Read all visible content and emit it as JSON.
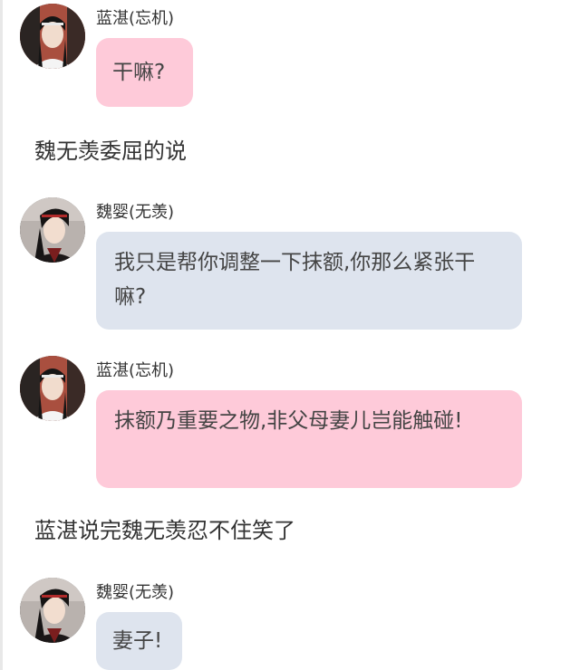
{
  "messages": [
    {
      "sender": "蓝湛(忘机)",
      "avatar": "lan-zhan-avatar",
      "text": "干嘛?",
      "bubble_color": "#fecad9"
    },
    {
      "sender": "魏婴(无羡)",
      "avatar": "wei-ying-avatar",
      "text": "我只是帮你调整一下抹额,你那么紧张干嘛?",
      "bubble_color": "#dee4ee"
    },
    {
      "sender": "蓝湛(忘机)",
      "avatar": "lan-zhan-avatar",
      "text": "抹额乃重要之物,非父母妻儿岂能触碰!",
      "bubble_color": "#fecad9"
    },
    {
      "sender": "魏婴(无羡)",
      "avatar": "wei-ying-avatar",
      "text": "妻子!",
      "bubble_color": "#dee4ee"
    }
  ],
  "narrations": [
    "魏无羡委屈的说",
    "蓝湛说完魏无羡忍不住笑了"
  ]
}
